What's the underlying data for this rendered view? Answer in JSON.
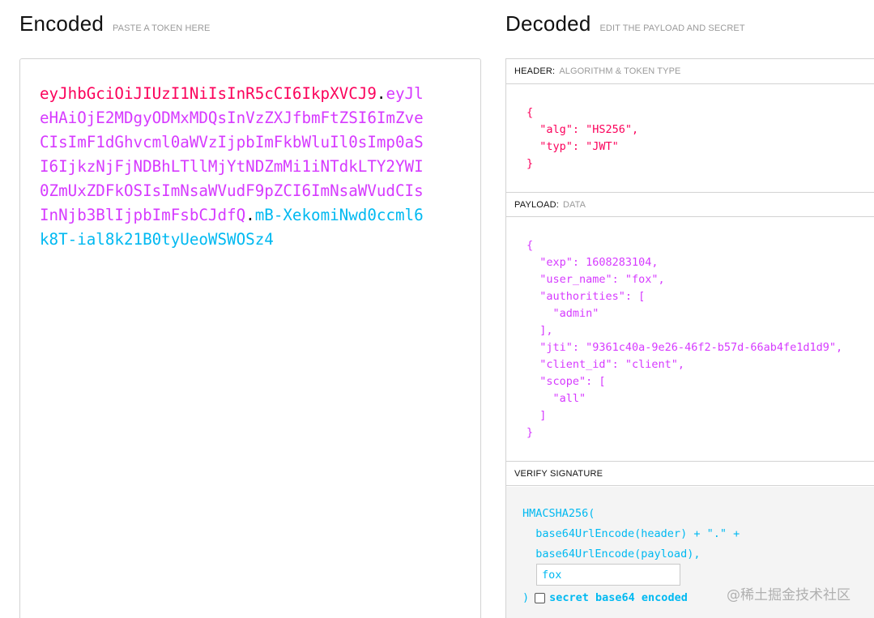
{
  "encoded": {
    "title": "Encoded",
    "subtitle": "PASTE A TOKEN HERE",
    "token_header": "eyJhbGciOiJIUzI1NiIsInR5cCI6IkpXVCJ9",
    "dot": ".",
    "token_payload": "eyJleHAiOjE2MDgyODMxMDQsInVzZXJfbmFtZSI6ImZveCIsImF1dGhvcml0aWVzIjpbImFkbWluIl0sImp0aSI6IjkzNjFjNDBhLTllMjYtNDZmMi1iNTdkLTY2YWI0ZmUxZDFkOSIsImNsaWVudF9pZCI6ImNsaWVudCIsInNjb3BlIjpbImFsbCJdfQ",
    "token_signature": "mB-XekomiNwd0ccml6k8T-ial8k21B0tyUeoWSWOSz4"
  },
  "decoded": {
    "title": "Decoded",
    "subtitle": "EDIT THE PAYLOAD AND SECRET",
    "header_section": {
      "label": "HEADER:",
      "desc": "ALGORITHM & TOKEN TYPE",
      "json": "{\n  \"alg\": \"HS256\",\n  \"typ\": \"JWT\"\n}"
    },
    "payload_section": {
      "label": "PAYLOAD:",
      "desc": "DATA",
      "json": "{\n  \"exp\": 1608283104,\n  \"user_name\": \"fox\",\n  \"authorities\": [\n    \"admin\"\n  ],\n  \"jti\": \"9361c40a-9e26-46f2-b57d-66ab4fe1d1d9\",\n  \"client_id\": \"client\",\n  \"scope\": [\n    \"all\"\n  ]\n}"
    },
    "signature_section": {
      "label": "VERIFY SIGNATURE",
      "code": "HMACSHA256(\n  base64UrlEncode(header) + \".\" +\n  base64UrlEncode(payload),",
      "secret_value": "fox",
      "close_paren": ")",
      "checkbox_label": "secret base64 encoded"
    }
  },
  "watermark": "@稀土掘金技术社区",
  "colors": {
    "header": "#fb015b",
    "payload": "#d63aff",
    "signature": "#00b9f1"
  }
}
